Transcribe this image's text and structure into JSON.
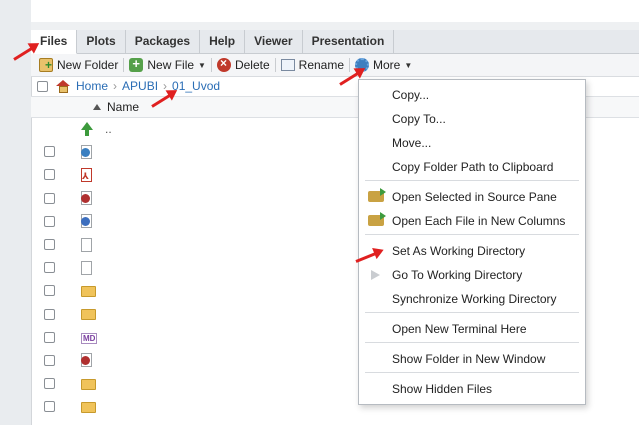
{
  "tabs": [
    "Files",
    "Plots",
    "Packages",
    "Help",
    "Viewer",
    "Presentation"
  ],
  "toolbar": {
    "new_folder": "New Folder",
    "new_file": "New File",
    "delete": "Delete",
    "rename": "Rename",
    "more": "More"
  },
  "breadcrumb": {
    "home": "Home",
    "folder1": "APUBI",
    "folder2": "01_Uvod"
  },
  "columns": {
    "name": "Name"
  },
  "parent_row": "..",
  "file_rows": [
    {
      "icon": "web-file-icon"
    },
    {
      "icon": "pdf-file-icon"
    },
    {
      "icon": "rdata-file-icon"
    },
    {
      "icon": "r-script-file-icon"
    },
    {
      "icon": "blank-file-icon"
    },
    {
      "icon": "blank-file-icon"
    },
    {
      "icon": "folder-icon"
    },
    {
      "icon": "folder-icon"
    },
    {
      "icon": "markdown-file-icon"
    },
    {
      "icon": "rdata-file-icon"
    },
    {
      "icon": "folder-icon"
    },
    {
      "icon": "folder-icon"
    }
  ],
  "menu": {
    "copy": "Copy...",
    "copy_to": "Copy To...",
    "move": "Move...",
    "copy_path": "Copy Folder Path to Clipboard",
    "open_selected": "Open Selected in Source Pane",
    "open_each": "Open Each File in New Columns",
    "set_wd": "Set As Working Directory",
    "goto_wd": "Go To Working Directory",
    "sync_wd": "Synchronize Working Directory",
    "terminal": "Open New Terminal Here",
    "show_window": "Show Folder in New Window",
    "show_hidden": "Show Hidden Files"
  },
  "colors": {
    "link": "#2a6db5",
    "annotation_arrow": "#e02020"
  }
}
